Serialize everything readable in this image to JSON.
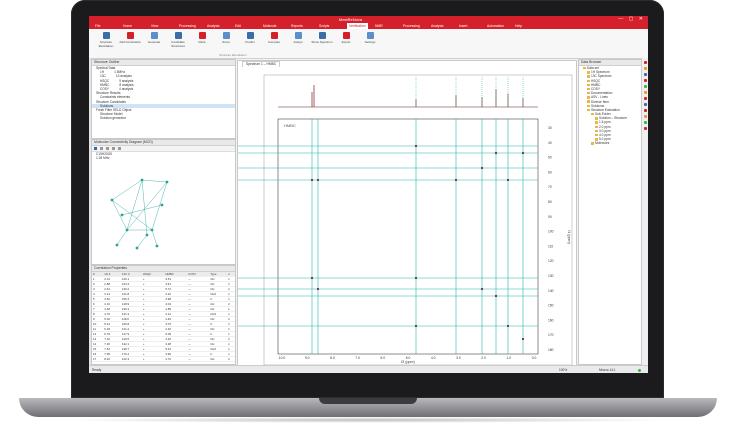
{
  "app": {
    "title": "MestReNova",
    "window_controls": "— ▢ ✕"
  },
  "menu": [
    "File",
    "Home",
    "View",
    "Processing",
    "Analysis",
    "Edit",
    "Molecule",
    "Reports",
    "Scripts",
    "Verification",
    "NMR",
    "Processing",
    "Analysis",
    "Insert",
    "Automation",
    "Help"
  ],
  "menu_active_index": 9,
  "ribbon": {
    "buttons": [
      "Structure Elucidation",
      "Add Constraints",
      "Generate",
      "Candidate Structures",
      "Rank",
      "Score",
      "Predict",
      "Compare",
      "Assign",
      "Show Spectrum",
      "Export",
      "Settings"
    ],
    "group_label": "Structure Elucidation"
  },
  "structure_outline": {
    "title": "Structure Outline",
    "items": [
      {
        "label": "Spectral Data",
        "depth": 0
      },
      {
        "label": "1H",
        "value": "1.5MHz",
        "depth": 1
      },
      {
        "label": "13C",
        "value": "13 analysis",
        "depth": 1
      },
      {
        "label": "HSQC",
        "value": "9 analysis",
        "depth": 1
      },
      {
        "label": "HMBC",
        "value": "8 analysis",
        "depth": 1
      },
      {
        "label": "COSY",
        "value": "4 analysis",
        "depth": 1
      },
      {
        "label": "Structure Results",
        "depth": 0
      },
      {
        "label": "Constraints elements",
        "depth": 1
      },
      {
        "label": "Structure Candidates",
        "depth": 0
      },
      {
        "label": "Solutions",
        "depth": 1,
        "selected": true
      },
      {
        "label": "Fresh Filter SELD Object",
        "depth": 0
      },
      {
        "label": "Structure Model",
        "depth": 1
      },
      {
        "label": "Solution generator",
        "depth": 1
      }
    ]
  },
  "cdp": {
    "title": "Molecular Connectivity Diagram (MCD)",
    "field1": "C15H20O5",
    "field2": "1.28 MHz"
  },
  "correlations": {
    "title": "Correlation Properties",
    "columns": [
      "#",
      "1H δ",
      "13C δ",
      "HSQC",
      "HMBC",
      "COSY",
      "Type",
      "n"
    ],
    "rows": [
      [
        "1",
        "2.01",
        "126.1",
        "+",
        "3.51",
        "—",
        "CH",
        "1"
      ],
      [
        "2",
        "2.88",
        "123.4",
        "+",
        "3.44",
        "—",
        "CH",
        "1"
      ],
      [
        "3",
        "2.61",
        "130.2",
        "+",
        "5.72",
        "—",
        "CH",
        "2"
      ],
      [
        "4",
        "3.14",
        "141.8",
        "+",
        "3.16",
        "—",
        "CH2",
        "1"
      ],
      [
        "5",
        "3.52",
        "156.4",
        "+",
        "2.98",
        "—",
        "C",
        "1"
      ],
      [
        "6",
        "4.10",
        "128.9",
        "+",
        "4.04",
        "—",
        "CH",
        "2"
      ],
      [
        "7",
        "4.48",
        "136.4",
        "+",
        "2.86",
        "—",
        "CH",
        "1"
      ],
      [
        "8",
        "4.76",
        "131.3",
        "+",
        "4.12",
        "—",
        "CH3",
        "1"
      ],
      [
        "9",
        "5.02",
        "118.6",
        "+",
        "4.46",
        "—",
        "CH",
        "2"
      ],
      [
        "10",
        "5.44",
        "166.8",
        "+",
        "3.76",
        "—",
        "C",
        "1"
      ],
      [
        "11",
        "6.18",
        "121.2",
        "+",
        "2.32",
        "—",
        "CH",
        "1"
      ],
      [
        "12",
        "6.79",
        "147.9",
        "+",
        "5.09",
        "—",
        "C",
        "1"
      ],
      [
        "13",
        "7.10",
        "129.5",
        "+",
        "4.26",
        "—",
        "CH",
        "2"
      ],
      [
        "14",
        "7.30",
        "132.1",
        "+",
        "3.38",
        "—",
        "CH",
        "1"
      ],
      [
        "15",
        "7.52",
        "138.7",
        "+",
        "5.44",
        "—",
        "CH2",
        "1"
      ],
      [
        "16",
        "7.95",
        "176.4",
        "+",
        "3.90",
        "—",
        "C",
        "1"
      ],
      [
        "17",
        "8.22",
        "142.3",
        "+",
        "4.72",
        "—",
        "CH",
        "2"
      ]
    ]
  },
  "spectrum": {
    "tab_label": "Spectrum 1 – HMBC",
    "experiment": "HMBC",
    "xlabel": "f2 (ppm)",
    "ylabel": "f1 (ppm)",
    "xticks": [
      "10.0",
      "9.0",
      "8.0",
      "7.0",
      "6.0",
      "5.0",
      "4.0",
      "3.0",
      "2.0",
      "1.0",
      "0.0"
    ],
    "yticks": [
      "30",
      "40",
      "50",
      "60",
      "70",
      "80",
      "90",
      "100",
      "110",
      "120",
      "130",
      "140",
      "150",
      "160",
      "170",
      "180"
    ]
  },
  "data_browser": {
    "title": "Data Browser",
    "items": [
      {
        "label": "Data set",
        "depth": 0
      },
      {
        "label": "1H Spectrum",
        "depth": 1
      },
      {
        "label": "13C Spectrum",
        "depth": 1
      },
      {
        "label": "HSQC",
        "depth": 1
      },
      {
        "label": "HMBC",
        "depth": 1
      },
      {
        "label": "COSY",
        "depth": 1
      },
      {
        "label": "Documentation",
        "depth": 1
      },
      {
        "label": "ASV - Lines",
        "depth": 1
      },
      {
        "label": "Diverse Item",
        "depth": 1
      },
      {
        "label": "Solutions",
        "depth": 1
      },
      {
        "label": "Structure Evaluation",
        "depth": 1
      },
      {
        "label": "Sub-Folder",
        "depth": 2
      },
      {
        "label": "Solution – Structure",
        "depth": 3
      },
      {
        "label": "1.5 ppm",
        "depth": 3
      },
      {
        "label": "2.0 ppm",
        "depth": 3
      },
      {
        "label": "3.0 ppm",
        "depth": 3
      },
      {
        "label": "4.0 ppm",
        "depth": 3
      },
      {
        "label": "5.0 ppm",
        "depth": 3
      },
      {
        "label": "Molecules",
        "depth": 2
      }
    ]
  },
  "status": {
    "left": "Ready",
    "right": "Mnova 14.1",
    "zoom": "100%"
  }
}
